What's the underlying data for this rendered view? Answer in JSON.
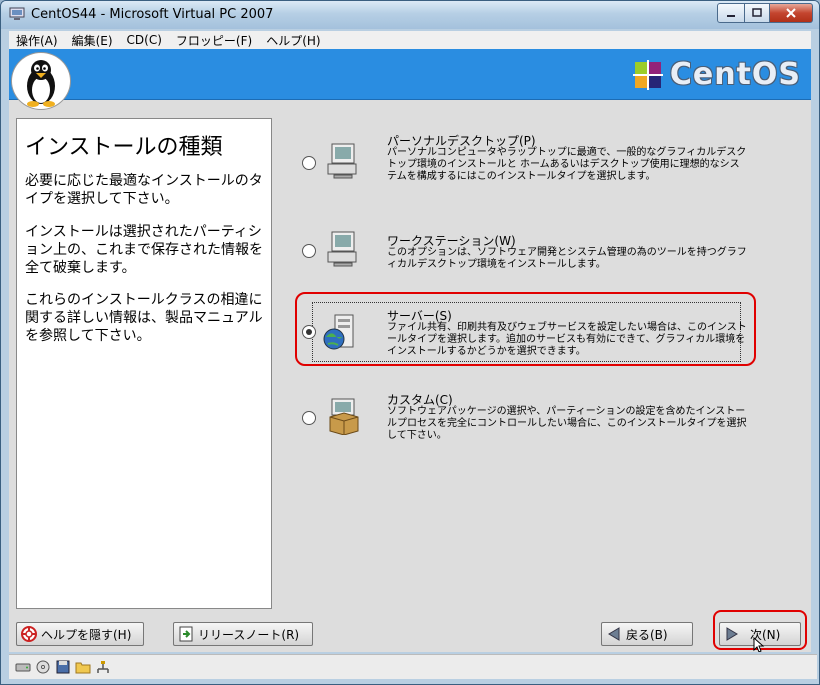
{
  "window": {
    "title": "CentOS44 - Microsoft Virtual PC 2007"
  },
  "menubar": {
    "items": [
      "操作(A)",
      "編集(E)",
      "CD(C)",
      "フロッピー(F)",
      "ヘルプ(H)"
    ]
  },
  "banner": {
    "logo_text": "CentOS"
  },
  "help": {
    "title": "インストールの種類",
    "paragraphs": [
      "必要に応じた最適なインストールのタイプを選択して下さい。",
      "インストールは選択されたパーティション上の、これまで保存された情報を全て破棄します。",
      "これらのインストールクラスの相違に関する詳しい情報は、製品マニュアルを参照して下さい。"
    ]
  },
  "options": [
    {
      "title": "パーソナルデスクトップ(P)",
      "desc": "パーソナルコンピュータやラップトップに最適で、一般的なグラフィカルデスクトップ環境のインストールと ホームあるいはデスクトップ使用に理想的なシステムを構成するにはこのインストールタイプを選択します。",
      "selected": false
    },
    {
      "title": "ワークステーション(W)",
      "desc": "このオプションは、ソフトウェア開発とシステム管理の為のツールを持つグラフィカルデスクトップ環境をインストールします。",
      "selected": false
    },
    {
      "title": "サーバー(S)",
      "desc": "ファイル共有、印刷共有及びウェブサービスを設定したい場合は、このインストールタイプを選択します。追加のサービスも有効にできて、グラフィカル環境を インストールするかどうかを選択できます。",
      "selected": true
    },
    {
      "title": "カスタム(C)",
      "desc": "ソフトウェアパッケージの選択や、パーティーションの設定を含めたインストールプロセスを完全にコントロールしたい場合に、このインストールタイプを選択して下さい。",
      "selected": false
    }
  ],
  "buttons": {
    "hide_help": "ヘルプを隠す(H)",
    "release_notes": "リリースノート(R)",
    "back": "戻る(B)",
    "next": "次(N)"
  },
  "colors": {
    "banner": "#2a8de1",
    "highlight": "#e00000"
  },
  "icons": [
    "penguin-icon",
    "centos-logo-icon",
    "desktop-computer-icon",
    "server-globe-icon",
    "package-box-icon",
    "lifebuoy-icon",
    "document-arrow-icon",
    "left-arrow-icon",
    "right-arrow-icon"
  ]
}
